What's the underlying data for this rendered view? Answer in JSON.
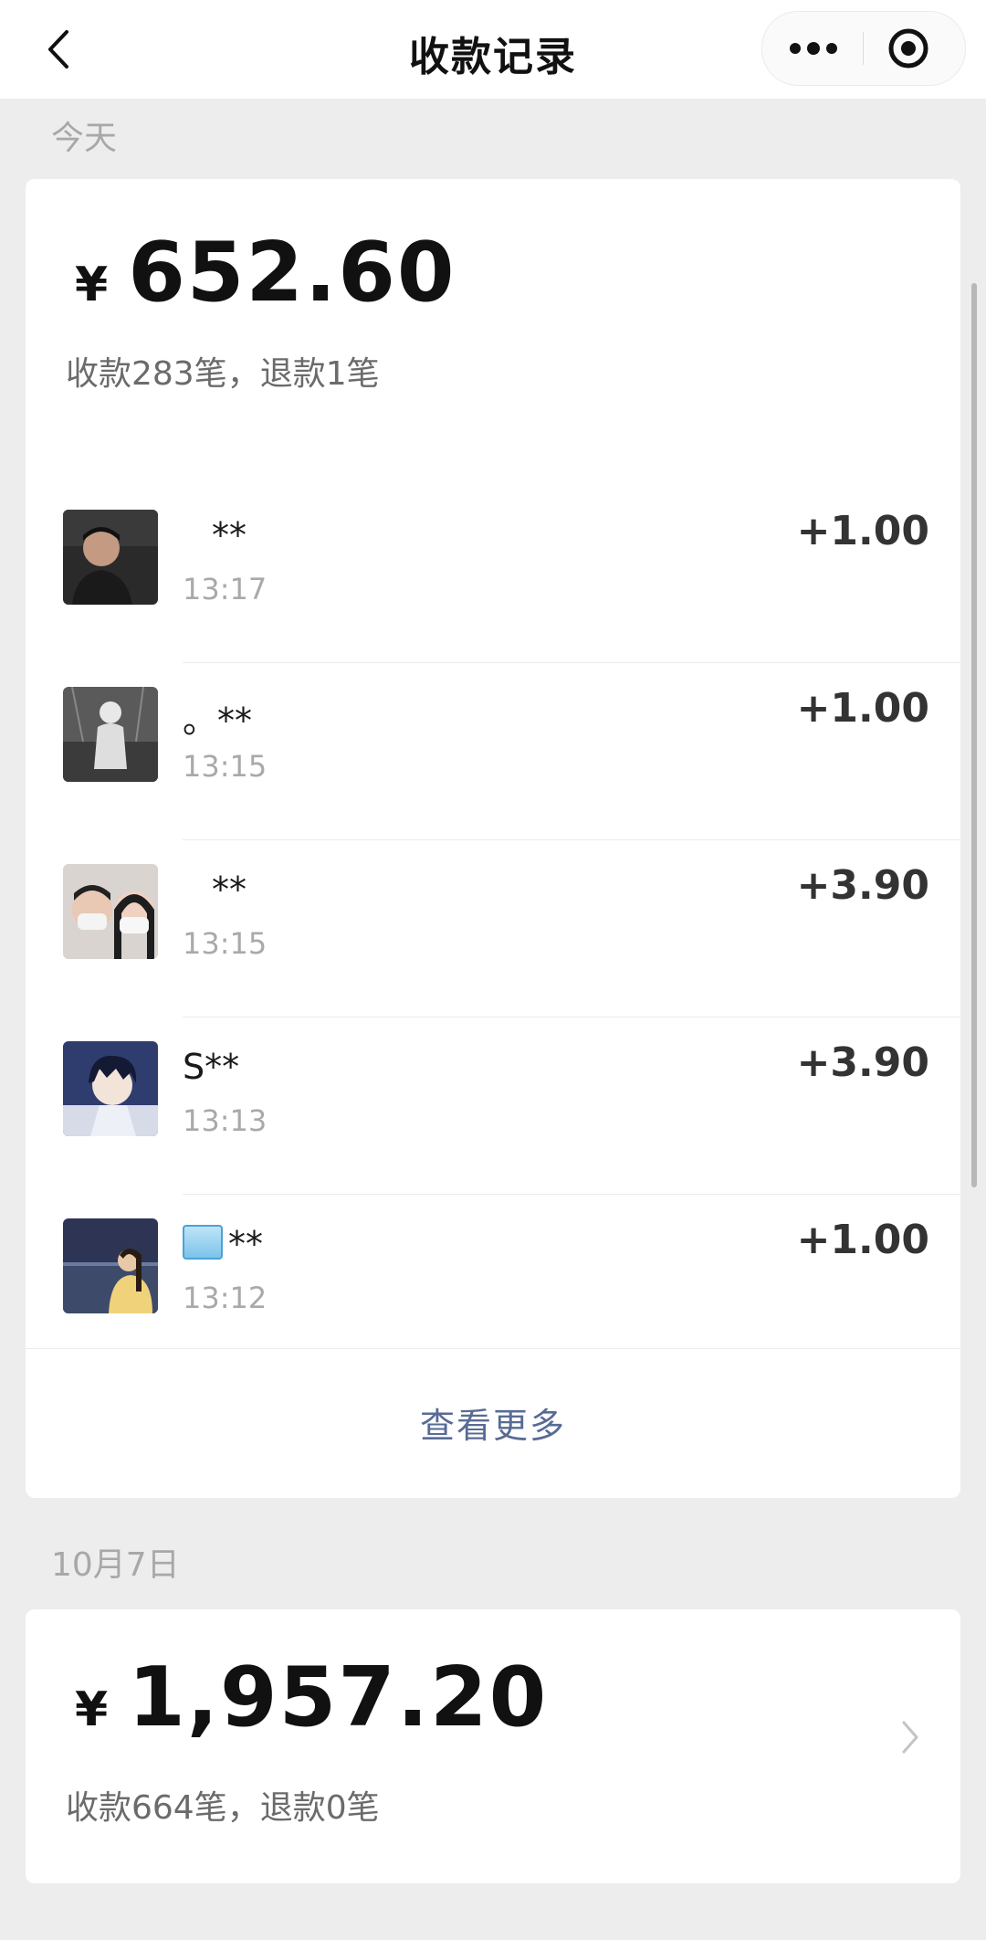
{
  "header": {
    "title": "收款记录",
    "back_icon": "chevron-left-icon",
    "more_icon": "more-dots-icon",
    "close_icon": "target-circle-icon"
  },
  "sections": [
    {
      "date": "今天",
      "currency": "¥",
      "total": "652.60",
      "summary": "收款283笔，退款1笔",
      "records": [
        {
          "name": "**",
          "time": "13:17",
          "amount": "+1.00",
          "avatar": "photo-man-dark"
        },
        {
          "name": "。**",
          "time": "13:15",
          "amount": "+1.00",
          "avatar": "photo-monochrome-figure"
        },
        {
          "name": "**",
          "time": "13:15",
          "amount": "+3.90",
          "avatar": "photo-couple-masks"
        },
        {
          "name": "S**",
          "time": "13:13",
          "amount": "+3.90",
          "avatar": "anime-boy"
        },
        {
          "name": "**",
          "time": "13:12",
          "amount": "+1.00",
          "avatar": "photo-night-sea",
          "emoji": "ice-cube-icon"
        }
      ],
      "see_more": "查看更多"
    },
    {
      "date": "10月7日",
      "currency": "¥",
      "total": "1,957.20",
      "summary": "收款664笔，退款0笔"
    }
  ],
  "colors": {
    "background": "#ededed",
    "card": "#ffffff",
    "link": "#576b95",
    "secondary_text": "#a9a9a9"
  }
}
